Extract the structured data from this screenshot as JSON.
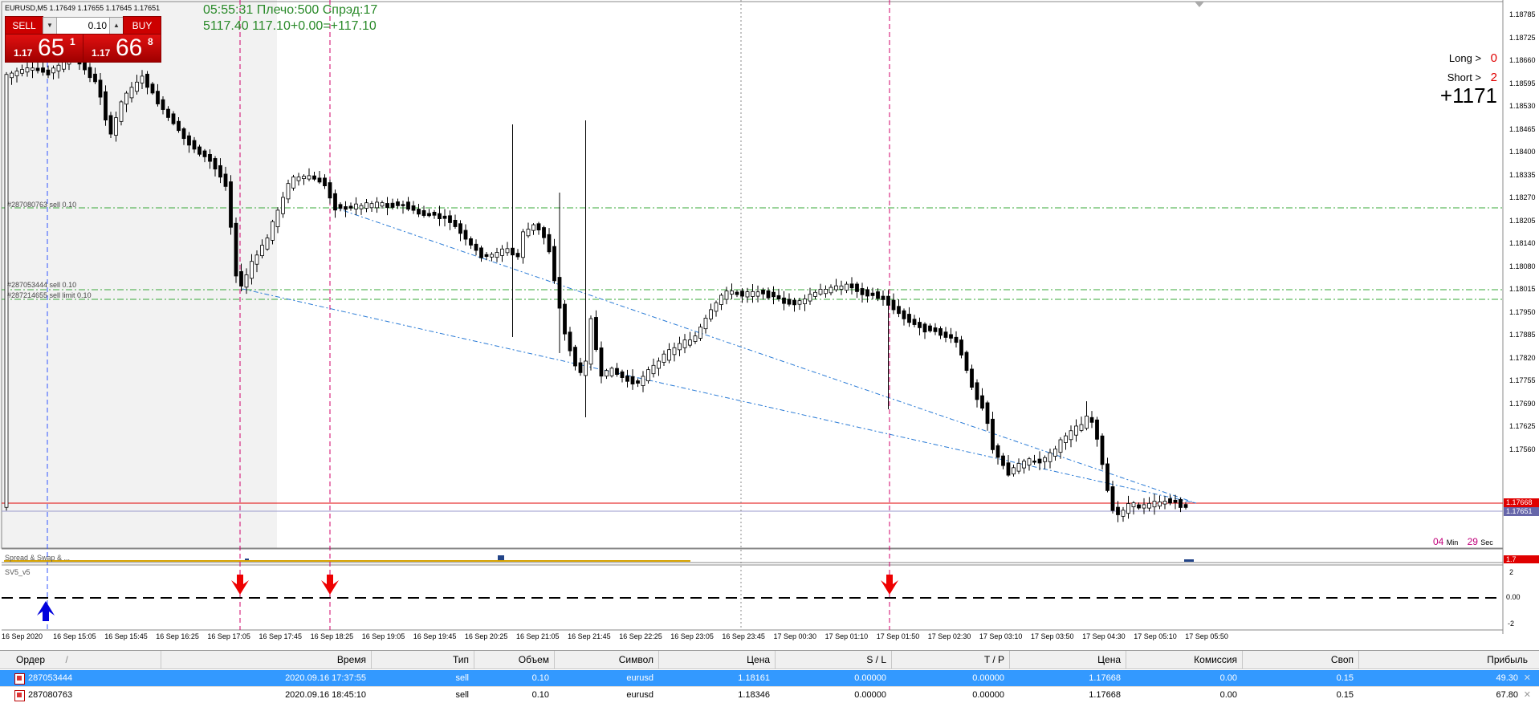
{
  "window": {
    "symbol_header": "EURUSD,M5  1.17649 1.17655 1.17645 1.17651",
    "subwindow1_label": "Spread & Swap & ...",
    "subwindow2_label": "SV5_v5"
  },
  "trade_panel": {
    "sell_label": "SELL",
    "buy_label": "BUY",
    "lot_value": "0.10",
    "sell_price_small": "1.17",
    "sell_price_big": "65",
    "sell_price_sup": "1",
    "buy_price_small": "1.17",
    "buy_price_big": "66",
    "buy_price_sup": "8"
  },
  "info": {
    "line1": "05:55:31 Плечо:500 Спрэд:17",
    "line2": "5117.40   117.10+0.00=+117.10"
  },
  "side_panel": {
    "long_label": "Long >",
    "long_value": "0",
    "short_label": "Short >",
    "short_value": "2",
    "total": "+1171"
  },
  "timer": {
    "min_value": "04",
    "min_label": "Min",
    "sec_value": "29",
    "sec_label": "Sec"
  },
  "chart_labels": {
    "order_line_1": "#287080763 sell 0.10",
    "order_line_2": "#287053444 sell 0.10",
    "order_line_3": "#287214655 sell limit 0.10"
  },
  "price_axis": [
    "1.18785",
    "1.18725",
    "1.18660",
    "1.18595",
    "1.18530",
    "1.18465",
    "1.18400",
    "1.18335",
    "1.18270",
    "1.18205",
    "1.18140",
    "1.18080",
    "1.18015",
    "1.17950",
    "1.17885",
    "1.17820",
    "1.17755",
    "1.17690",
    "1.17625",
    "1.17560"
  ],
  "price_tags": {
    "ask": "1.17668",
    "bid": "1.17651",
    "spread": "1.7"
  },
  "indicator_axis": [
    "2",
    "0.00",
    "-2"
  ],
  "time_axis": [
    "16 Sep 2020",
    "16 Sep 15:05",
    "16 Sep 15:45",
    "16 Sep 16:25",
    "16 Sep 17:05",
    "16 Sep 17:45",
    "16 Sep 18:25",
    "16 Sep 19:05",
    "16 Sep 19:45",
    "16 Sep 20:25",
    "16 Sep 21:05",
    "16 Sep 21:45",
    "16 Sep 22:25",
    "16 Sep 23:05",
    "16 Sep 23:45",
    "17 Sep 00:30",
    "17 Sep 01:10",
    "17 Sep 01:50",
    "17 Sep 02:30",
    "17 Sep 03:10",
    "17 Sep 03:50",
    "17 Sep 04:30",
    "17 Sep 05:10",
    "17 Sep 05:50"
  ],
  "orders": {
    "headers": [
      "Ордер",
      "/",
      "Время",
      "Тип",
      "Объем",
      "Символ",
      "Цена",
      "S / L",
      "T / P",
      "Цена",
      "Комиссия",
      "Своп",
      "Прибыль"
    ],
    "rows": [
      {
        "order": "287053444",
        "time": "2020.09.16 17:37:55",
        "type": "sell",
        "volume": "0.10",
        "symbol": "eurusd",
        "price": "1.18161",
        "sl": "0.00000",
        "tp": "0.00000",
        "current": "1.17668",
        "commission": "0.00",
        "swap": "0.15",
        "profit": "49.30"
      },
      {
        "order": "287080763",
        "time": "2020.09.16 18:45:10",
        "type": "sell",
        "volume": "0.10",
        "symbol": "eurusd",
        "price": "1.18346",
        "sl": "0.00000",
        "tp": "0.00000",
        "current": "1.17668",
        "commission": "0.00",
        "swap": "0.15",
        "profit": "67.80"
      }
    ]
  },
  "colors": {
    "sell_red": "#cc0000",
    "info_green": "#2a8a2a",
    "arrow_red": "#ff0000",
    "arrow_blue": "#0000dd",
    "selection_blue": "#3399ff"
  },
  "icons": {
    "close": "close-icon",
    "order_sell": "sell-order-icon"
  }
}
